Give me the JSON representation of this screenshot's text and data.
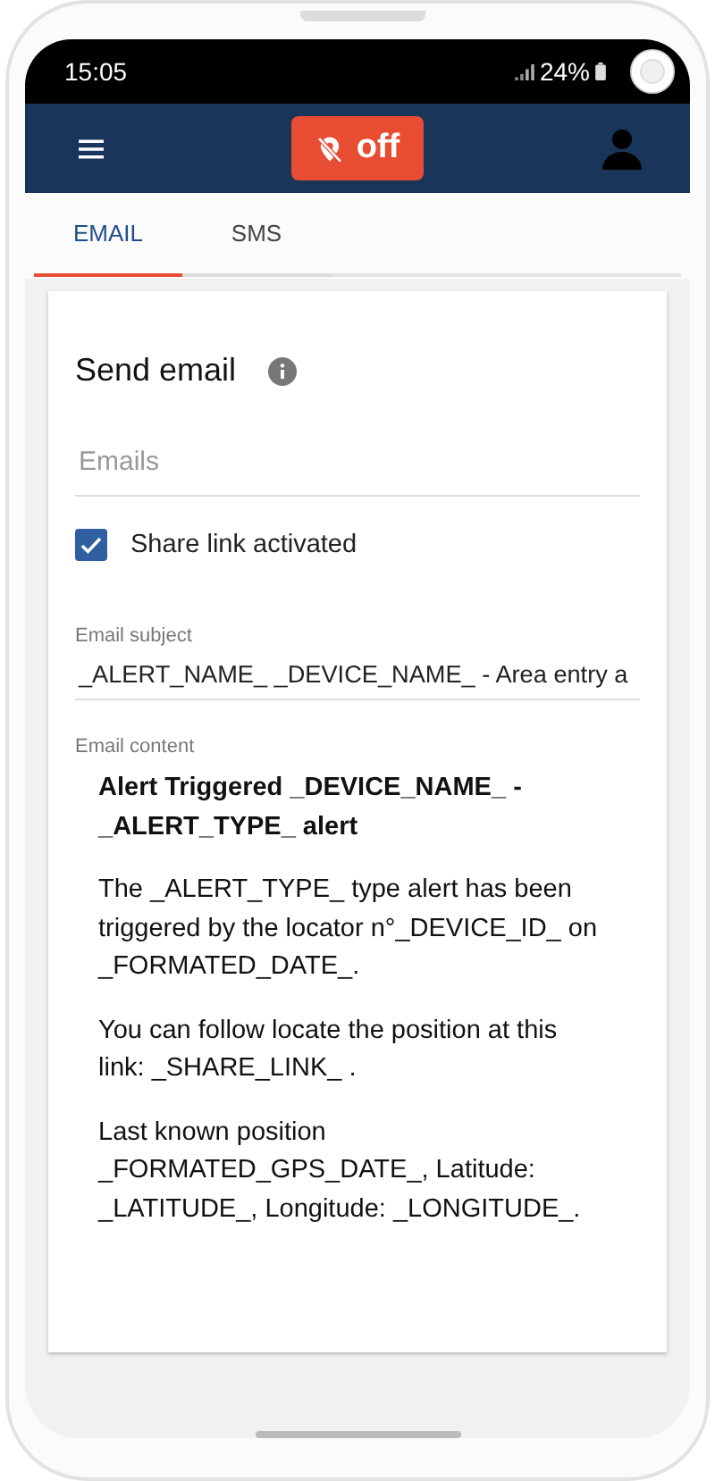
{
  "status_bar": {
    "time": "15:05",
    "battery": "24%"
  },
  "header": {
    "alert_toggle": {
      "label": "off",
      "on": false
    }
  },
  "tabs": [
    {
      "label": "EMAIL",
      "selected": true
    },
    {
      "label": "SMS",
      "selected": false
    }
  ],
  "form": {
    "title": "Send email",
    "emails": {
      "placeholder": "Emails"
    },
    "share_link": {
      "label": "Share link activated",
      "checked": true
    },
    "subject": {
      "label": "Email subject",
      "value": "_ALERT_NAME_ _DEVICE_NAME_ - Area entry a"
    },
    "content": {
      "label": "Email content",
      "heading": "Alert Triggered _DEVICE_NAME_ - _ALERT_TYPE_ alert",
      "paragraphs": [
        "The _ALERT_TYPE_ type alert has been triggered by the locator n°_DEVICE_ID_ on _FORMATED_DATE_.",
        "You can follow locate the position at this link: _SHARE_LINK_ .",
        "Last known position _FORMATED_GPS_DATE_, Latitude: _LATITUDE_, Longitude: _LONGITUDE_."
      ]
    }
  }
}
